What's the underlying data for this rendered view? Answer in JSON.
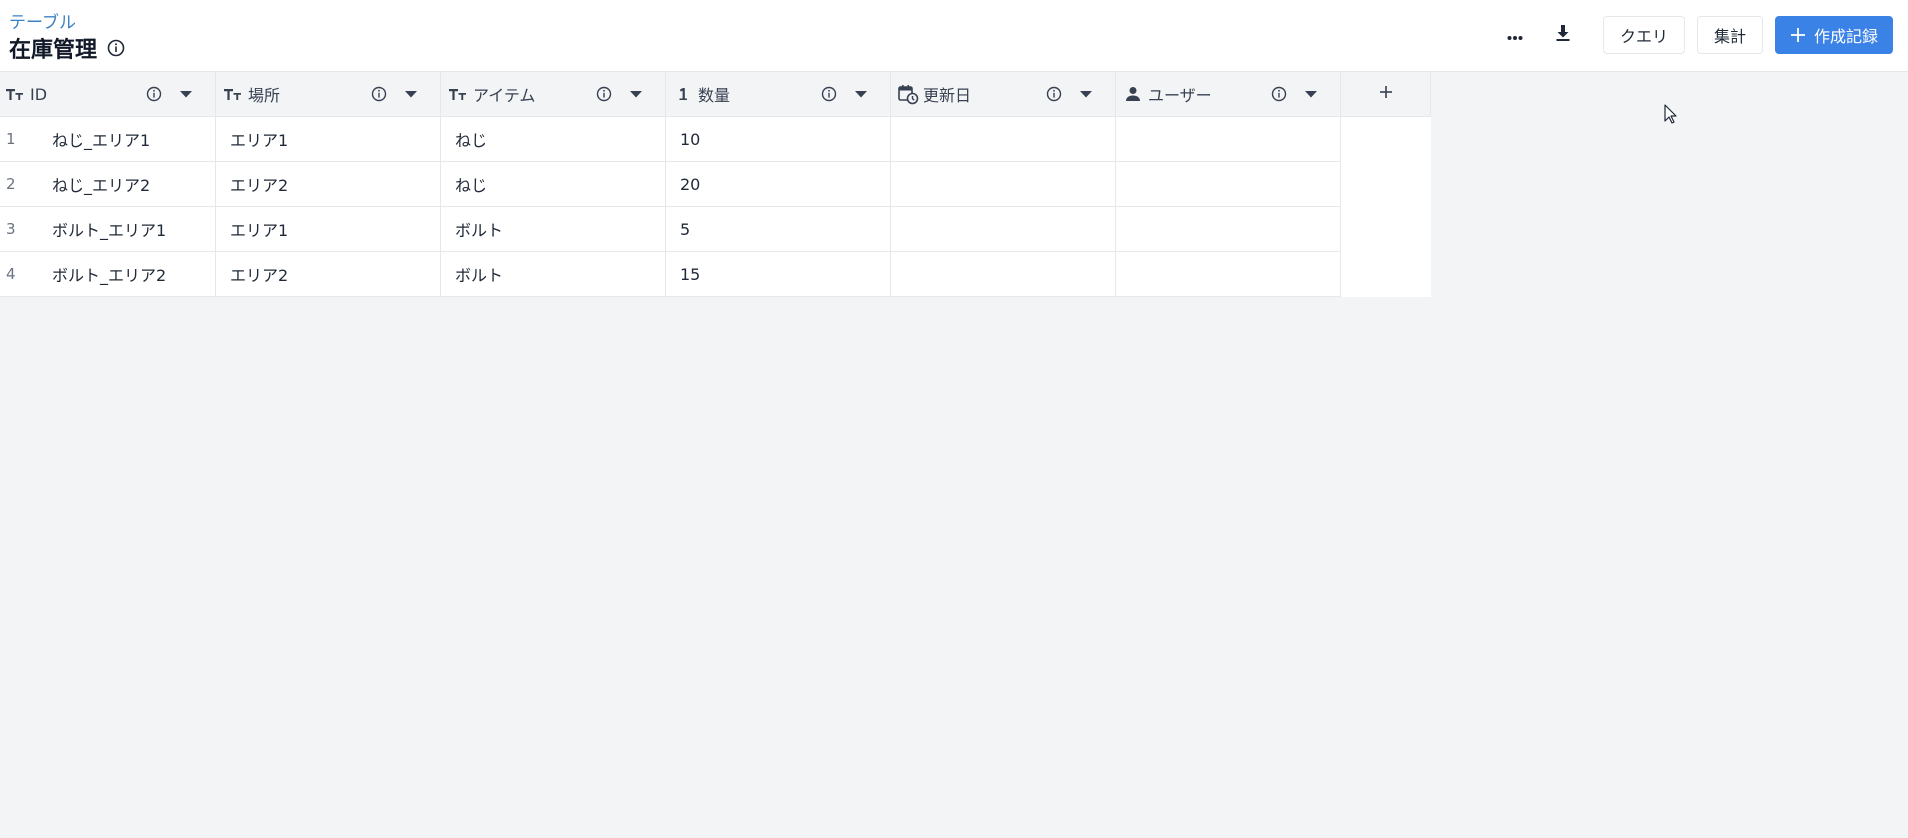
{
  "header": {
    "breadcrumb": "テーブル",
    "title": "在庫管理"
  },
  "toolbar": {
    "query_label": "クエリ",
    "aggregate_label": "集計",
    "create_label": "作成記録"
  },
  "table": {
    "columns": [
      {
        "label": "ID",
        "type_icon": "text-type-icon"
      },
      {
        "label": "場所",
        "type_icon": "text-type-icon"
      },
      {
        "label": "アイテム",
        "type_icon": "text-type-icon"
      },
      {
        "label": "数量",
        "type_icon": "number-type-icon"
      },
      {
        "label": "更新日",
        "type_icon": "date-type-icon"
      },
      {
        "label": "ユーザー",
        "type_icon": "user-type-icon"
      }
    ],
    "rows": [
      {
        "num": "1",
        "id": "ねじ_エリア1",
        "location": "エリア1",
        "item": "ねじ",
        "qty": "10",
        "updated": "",
        "user": ""
      },
      {
        "num": "2",
        "id": "ねじ_エリア2",
        "location": "エリア2",
        "item": "ねじ",
        "qty": "20",
        "updated": "",
        "user": ""
      },
      {
        "num": "3",
        "id": "ボルト_エリア1",
        "location": "エリア1",
        "item": "ボルト",
        "qty": "5",
        "updated": "",
        "user": ""
      },
      {
        "num": "4",
        "id": "ボルト_エリア2",
        "location": "エリア2",
        "item": "ボルト",
        "qty": "15",
        "updated": "",
        "user": ""
      }
    ]
  },
  "colors": {
    "accent": "#3b82e6",
    "breadcrumb": "#3b82c4",
    "background": "#f3f4f6"
  }
}
